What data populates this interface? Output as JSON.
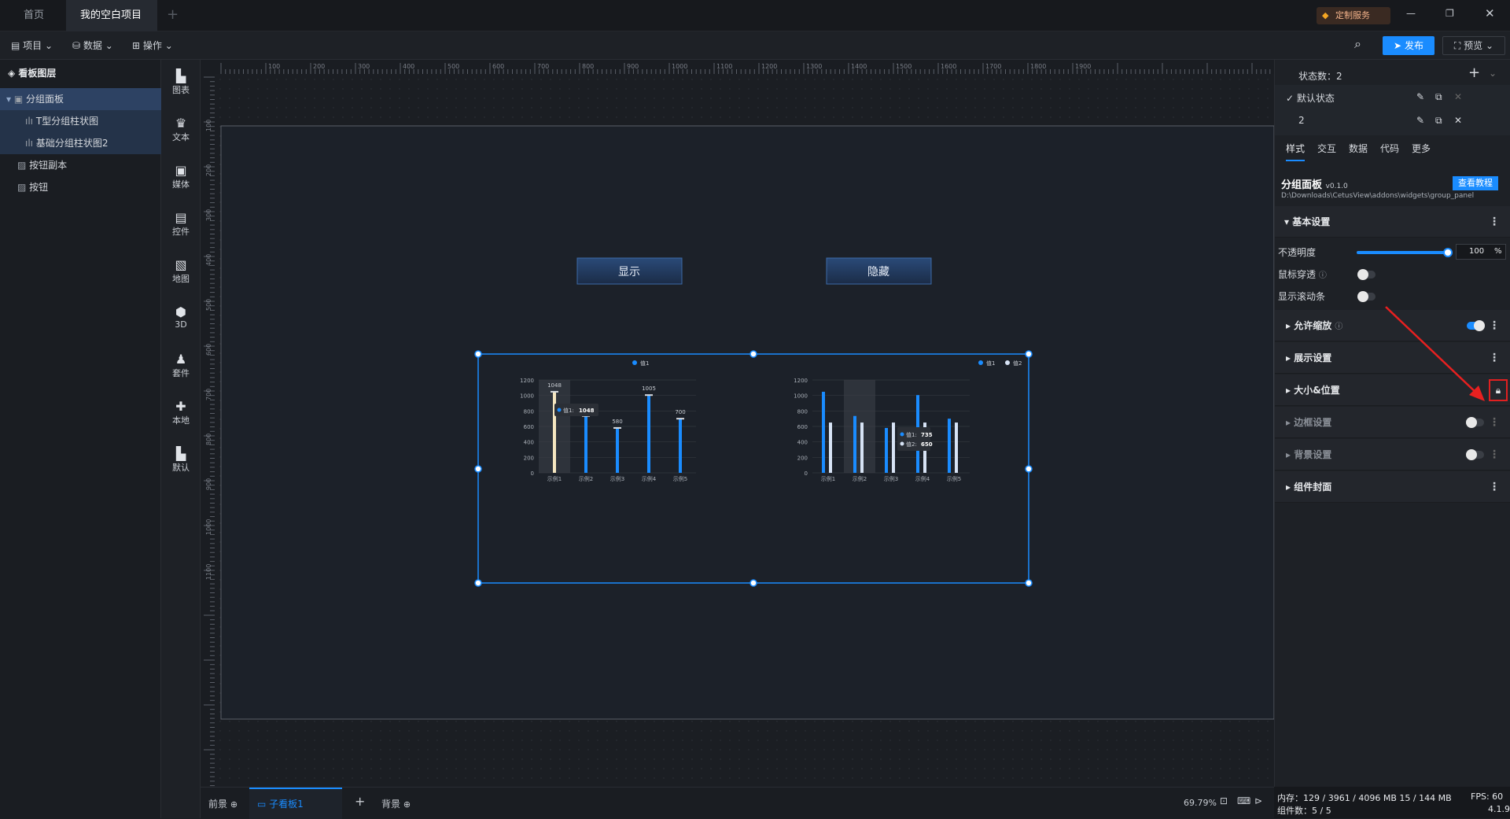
{
  "titlebar": {
    "tabs": [
      {
        "label": "首页"
      },
      {
        "label": "我的空白项目"
      }
    ],
    "custom_service": "定制服务"
  },
  "toolbar": {
    "menus": [
      {
        "label": "项目"
      },
      {
        "label": "数据"
      },
      {
        "label": "操作"
      }
    ],
    "publish": "发布",
    "preview": "预览"
  },
  "layers": {
    "title": "看板图层",
    "items": [
      {
        "label": "分组面板"
      },
      {
        "label": "T型分组柱状图"
      },
      {
        "label": "基础分组柱状图2"
      },
      {
        "label": "按钮副本"
      },
      {
        "label": "按钮"
      }
    ]
  },
  "iconbar": [
    {
      "label": "图表",
      "icon": "chart-icon"
    },
    {
      "label": "文本",
      "icon": "text-icon"
    },
    {
      "label": "媒体",
      "icon": "media-icon"
    },
    {
      "label": "控件",
      "icon": "control-icon"
    },
    {
      "label": "地图",
      "icon": "map-icon"
    },
    {
      "label": "3D",
      "icon": "cube-icon"
    },
    {
      "label": "套件",
      "icon": "shirt-icon"
    },
    {
      "label": "本地",
      "icon": "puzzle-icon"
    },
    {
      "label": "默认",
      "icon": "chart-icon"
    }
  ],
  "ruler": {
    "x_ticks": [
      "100",
      "200",
      "300",
      "400",
      "500",
      "600",
      "700",
      "800",
      "900",
      "1000",
      "1100",
      "1200",
      "1300",
      "1400",
      "1500",
      "1600",
      "1700",
      "1800",
      "1900"
    ],
    "y_ticks": [
      "100",
      "200",
      "300",
      "400",
      "500",
      "600",
      "700",
      "800",
      "900",
      "1000",
      "1100"
    ]
  },
  "canvas": {
    "show_button": "显示",
    "hide_button": "隐藏"
  },
  "chart_data": [
    {
      "type": "bar",
      "categories": [
        "示例1",
        "示例2",
        "示例3",
        "示例4",
        "示例5"
      ],
      "series": [
        {
          "name": "值1",
          "values": [
            1048,
            735,
            580,
            1005,
            700
          ]
        }
      ],
      "data_labels": [
        "1048",
        "",
        "580",
        "1005",
        "700"
      ],
      "ylim": [
        0,
        1200
      ],
      "yticks": [
        "0",
        "200",
        "400",
        "600",
        "800",
        "1000",
        "1200"
      ],
      "tooltip": {
        "label": "值1:",
        "value": "1048"
      },
      "colors": [
        "#1a8cff",
        "#f5e6c0"
      ]
    },
    {
      "type": "bar",
      "categories": [
        "示例1",
        "示例2",
        "示例3",
        "示例4",
        "示例5"
      ],
      "series": [
        {
          "name": "值1",
          "values": [
            1048,
            735,
            580,
            1005,
            700
          ]
        },
        {
          "name": "值2",
          "values": [
            650,
            650,
            650,
            650,
            650
          ]
        }
      ],
      "ylim": [
        0,
        1200
      ],
      "yticks": [
        "0",
        "200",
        "400",
        "600",
        "800",
        "1000",
        "1200"
      ],
      "tooltip": [
        {
          "label": "值1:",
          "value": "735"
        },
        {
          "label": "值2:",
          "value": "650"
        }
      ],
      "colors": [
        "#1a8cff",
        "#d7e3f5"
      ]
    }
  ],
  "bottombar": {
    "front": "前景",
    "tab": "子看板1",
    "back": "背景",
    "zoom": "69.79%"
  },
  "rightpanel": {
    "state_count": "状态数：2",
    "states": [
      {
        "label": "默认状态"
      },
      {
        "label": "2"
      }
    ],
    "tabs": [
      {
        "label": "样式"
      },
      {
        "label": "交互"
      },
      {
        "label": "数据"
      },
      {
        "label": "代码"
      },
      {
        "label": "更多"
      }
    ],
    "widget_name": "分组面板",
    "version": "v0.1.0",
    "tutorial": "查看教程",
    "path": "D:\\Downloads\\CetusView\\addons\\widgets\\group_panel",
    "basic_settings": "基本设置",
    "opacity_label": "不透明度",
    "opacity_value": "100",
    "opacity_unit": "%",
    "mouse_through": "鼠标穿透",
    "show_scrollbar": "显示滚动条",
    "sections": [
      {
        "label": "允许缩放"
      },
      {
        "label": "展示设置"
      },
      {
        "label": "大小&位置"
      },
      {
        "label": "边框设置"
      },
      {
        "label": "背景设置"
      },
      {
        "label": "组件封面"
      }
    ]
  },
  "status": {
    "memory": "内存：129 / 3961 / 4096 MB 15 / 144 MB",
    "fps": "FPS:   60",
    "components": "组件数：5 / 5",
    "version": "4.1.9"
  }
}
